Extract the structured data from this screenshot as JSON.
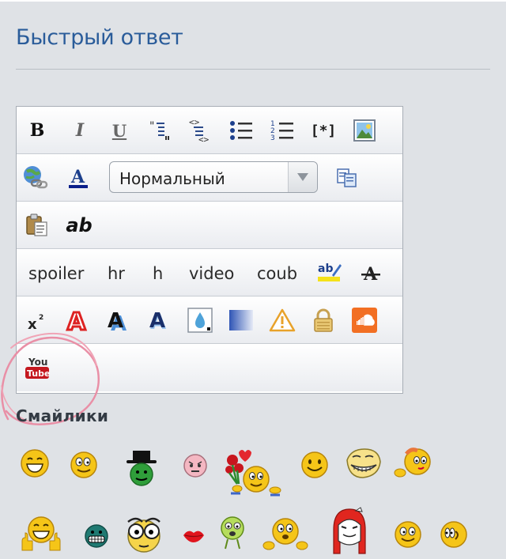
{
  "title": "Быстрый ответ",
  "editor": {
    "font_select_value": "Нормальный",
    "text_buttons": [
      "spoiler",
      "hr",
      "h",
      "video",
      "coub"
    ],
    "bold_glyph": "B",
    "italic_glyph": "I",
    "underline_glyph": "U",
    "list_bracket_glyph": "[*]",
    "spellcheck_glyph": "ab",
    "plain_text_glyph": "ab",
    "youtube_text_top": "You",
    "youtube_text_bottom": "Tube",
    "icons": [
      "bold-icon",
      "italic-icon",
      "underline-icon",
      "quote-icon",
      "code-icon",
      "bullet-list-icon",
      "numbered-list-icon",
      "list-item-icon",
      "image-icon",
      "link-icon",
      "font-color-icon",
      "copy-icon",
      "paste-icon",
      "plain-text-icon",
      "spellcheck-icon",
      "strikethrough-icon",
      "superscript-icon",
      "font-outline-icon",
      "font-shadow-icon",
      "font-shadow-blue-icon",
      "drop-icon",
      "gradient-icon",
      "warning-icon",
      "lock-icon",
      "soundcloud-icon",
      "youtube-icon"
    ]
  },
  "smilies_label": "Смайлики",
  "colors": {
    "title": "#2a5c9a",
    "background": "#dfe2e6",
    "smiley": "#f5c518"
  }
}
